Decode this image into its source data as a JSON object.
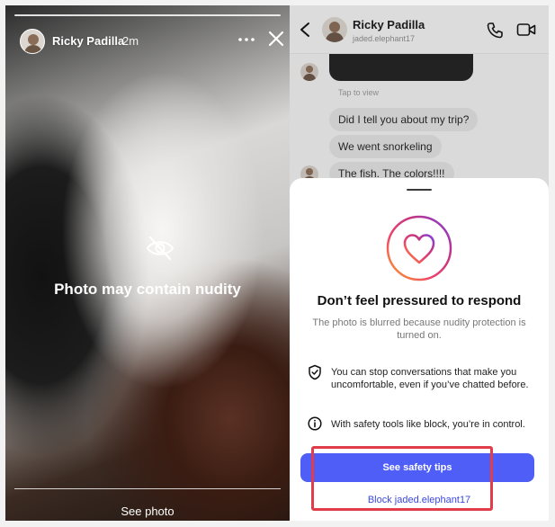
{
  "story": {
    "username": "Ricky Padilla",
    "time": "2m",
    "warning": "Photo may contain nudity",
    "see_photo": "See photo"
  },
  "chat": {
    "name": "Ricky Padilla",
    "handle": "jaded.elephant17",
    "tap_to_view": "Tap to view",
    "messages": [
      "Did I tell you about my trip?",
      "We went snorkeling",
      "The fish. The colors!!!!"
    ]
  },
  "sheet": {
    "title": "Don’t feel pressured to respond",
    "subtitle": "The photo is blurred because nudity protection is turned on.",
    "rows": [
      "You can stop conversations that make you uncomfortable, even if you’ve chatted before.",
      "With safety tools like block, you’re in control."
    ],
    "primary_button": "See safety tips",
    "block_link": "Block jaded.elephant17"
  },
  "colors": {
    "accent": "#4f5ef7",
    "link": "#3b48e0",
    "highlight": "#e03c4a"
  },
  "icons": {
    "more": "more-horizontal-icon",
    "close": "close-icon",
    "eye_off": "eye-off-icon",
    "back": "chevron-left-icon",
    "phone": "phone-icon",
    "video": "video-icon",
    "heart": "heart-icon",
    "shield": "shield-icon",
    "info": "info-icon"
  }
}
